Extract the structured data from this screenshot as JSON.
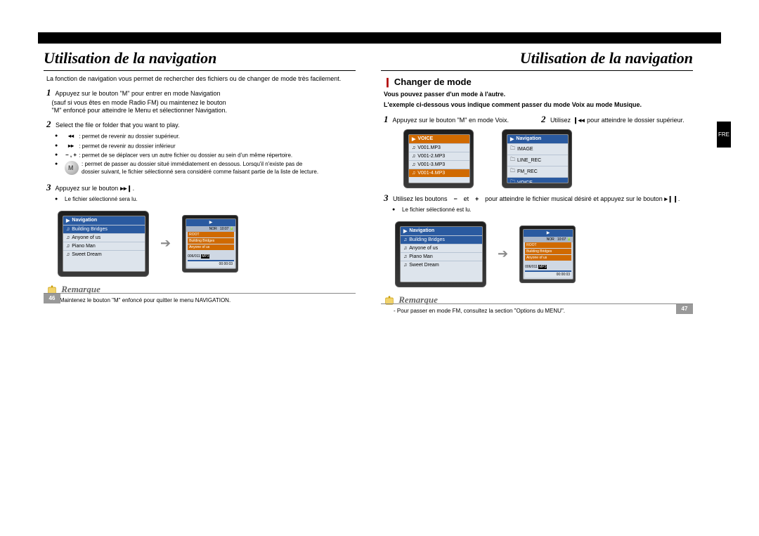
{
  "lang_tab": "FRE",
  "left": {
    "title": "Utilisation de la navigation",
    "intro": "La fonction de navigation vous permet de rechercher des fichiers ou de changer de mode très facilement.",
    "step1_a": "Appuyez sur le bouton \"M\" pour entrer en mode Navigation",
    "step1_b": "(sauf si vous êtes en mode Radio FM) ou maintenez le bouton",
    "step1_c": "\"M\" enfoncé pour atteindre le Menu et sélectionner Navigation.",
    "step2": "Select the file or folder that you want to play.",
    "b1_icon": "◂◂",
    "b1_txt": ": permet de revenir au dossier supérieur.",
    "b2_icon": "▸▸",
    "b2_txt": ": permet de revenir au dossier inférieur",
    "b3_icon": "− , +",
    "b3_txt": ": permet de se déplacer vers un autre fichier ou dossier au sein d'un même répertoire.",
    "b4_txt": ": permet de passer au dossier situé immédiatement en dessous. Lorsqu'il n'existe pas de dossier suivant, le fichier sélectionné sera considéré comme faisant partie de la liste de lecture.",
    "step3": "Appuyez sur le bouton",
    "step3_icon": "▸▸❙",
    "step3_dot": ".",
    "step3_b": "Le fichier sélectionné sera lu.",
    "remark_label": "Remarque",
    "remark_txt": "- Maintenez le bouton \"M\" enfoncé pour quitter le menu NAVIGATION.",
    "page_num": "46",
    "mock": {
      "nav_header": "Navigation",
      "rows": [
        "Building Bridges",
        "Anyone of us",
        "Piano Man",
        "Sweet Dream"
      ],
      "play_top": "▶",
      "play_info1": "NOR",
      "play_info2": "10:07",
      "play_r1": "ROOT",
      "play_r2": "Building Bridges",
      "play_r3": "Anyone of us",
      "play_track": "006/011",
      "play_time": "00:00:03"
    }
  },
  "right": {
    "title": "Utilisation de la navigation",
    "subtitle": "Changer de mode",
    "sub_intro1": "Vous pouvez passer d'un mode à l'autre.",
    "sub_intro2": "L'exemple ci-dessous vous indique comment passer du mode Voix au mode Musique.",
    "step1": "Appuyez sur le bouton \"M\" en mode Voix.",
    "step2_a": "Utilisez",
    "step2_icon": "❙◂◂",
    "step2_b": "pour atteindre le dossier supérieur.",
    "step3_a": "Utilisez les boutons",
    "step3_icon1": "−",
    "step3_mid": "et",
    "step3_icon2": "+",
    "step3_b": "pour atteindre le fichier musical désiré et appuyez sur le bouton",
    "step3_icon3": "▸❙❙",
    "step3_dot": ".",
    "step3_bullet": "Le fichier sélectionné est lu.",
    "remark_label": "Remarque",
    "remark_txt": "- Pour passer en mode FM, consultez la section \"Options du MENU\".",
    "page_num": "47",
    "mock_voice": {
      "header": "VOICE",
      "rows": [
        "V001.MP3",
        "V001-2.MP3",
        "V001-3.MP3",
        "V001-4.MP3"
      ]
    },
    "mock_nav2": {
      "header": "Navigation",
      "rows": [
        "IMAGE",
        "LINE_REC",
        "FM_REC",
        "VOICE"
      ]
    },
    "mock_bottom": {
      "nav_header": "Navigation",
      "rows": [
        "Building Bridges",
        "Anyone of us",
        "Piano Man",
        "Sweet Dream"
      ],
      "play_info1": "NOR",
      "play_info2": "10:07",
      "play_r1": "ROOT",
      "play_r2": "Building Bridges",
      "play_r3": "Anyone of us",
      "play_track": "006/011",
      "play_time": "00:00:03"
    }
  }
}
